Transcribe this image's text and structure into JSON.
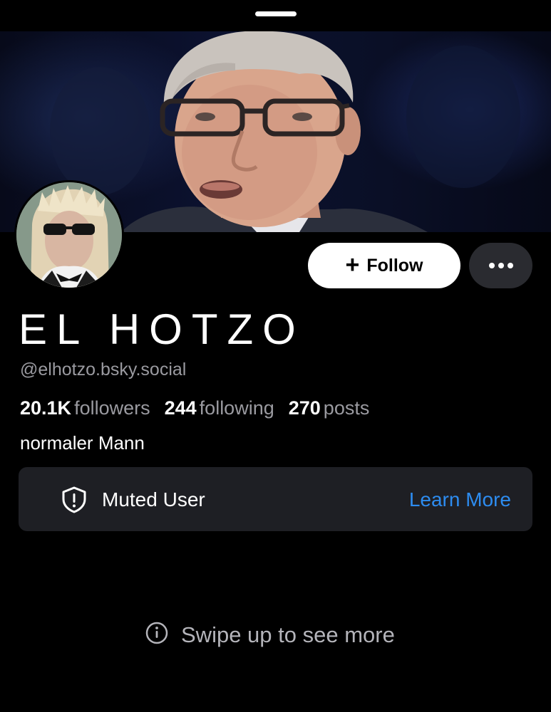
{
  "profile": {
    "display_name": "EL HOTZO",
    "handle": "@elhotzo.bsky.social",
    "bio": "normaler Mann"
  },
  "stats": {
    "followers_count": "20.1K",
    "followers_label": "followers",
    "following_count": "244",
    "following_label": "following",
    "posts_count": "270",
    "posts_label": "posts"
  },
  "actions": {
    "follow_label": "Follow",
    "more_icon": "ellipsis-icon"
  },
  "moderation": {
    "label": "Muted User",
    "learn_more": "Learn More",
    "icon": "shield-alert-icon"
  },
  "hint": {
    "text": "Swipe up to see more",
    "icon": "info-icon"
  },
  "colors": {
    "background": "#000000",
    "accent_link": "#2d8cf0",
    "card": "#1e1f24",
    "muted_text": "#9a9aa0"
  }
}
